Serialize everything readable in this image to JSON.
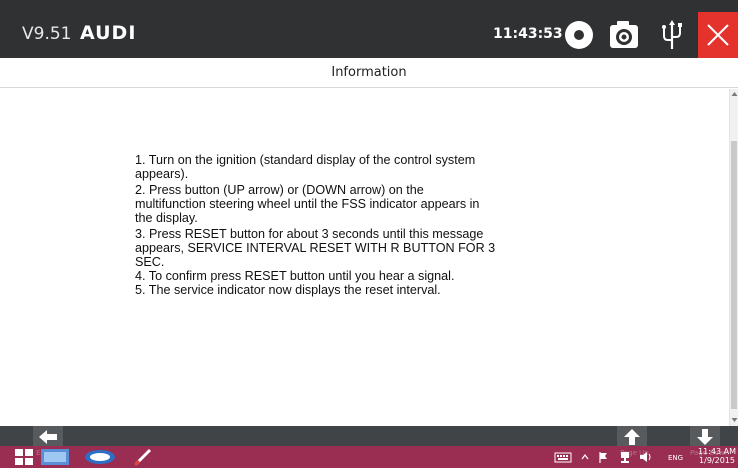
{
  "header": {
    "version": "V9.51",
    "brand": "AUDI",
    "time": "11:43:53",
    "icons": [
      "record-icon",
      "camera-icon",
      "usb-icon",
      "close-icon"
    ],
    "close_color": "#e4322d",
    "background": "#2f3133"
  },
  "title": "Information",
  "content": {
    "lines": [
      "1. Turn on the ignition (standard display of the control system",
      "appears).",
      "2. Press button (UP arrow) or (DOWN arrow) on the",
      "multifunction steering wheel until the FSS indicator appears in",
      "the display.",
      "3. Press RESET button for about 3 seconds until this message",
      "appears, SERVICE INTERVAL RESET WITH R BUTTON FOR 3",
      "SEC.",
      "4. To confirm press RESET button until you hear a signal.",
      "5. The service indicator now displays the reset interval."
    ]
  },
  "bottom_nav": {
    "back_label": "Esc",
    "page_up_label": "Page Up",
    "page_down_label": "Page Down"
  },
  "taskbar": {
    "lang": "ENG",
    "time": "11:43 AM",
    "date": "1/9/2015",
    "color": "#9a2e52"
  }
}
